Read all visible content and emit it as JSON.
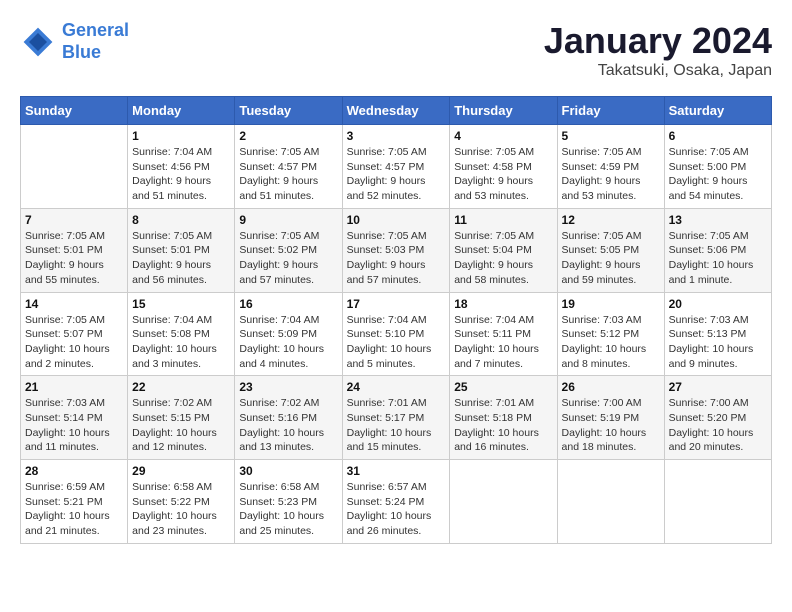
{
  "header": {
    "logo_line1": "General",
    "logo_line2": "Blue",
    "title": "January 2024",
    "subtitle": "Takatsuki, Osaka, Japan"
  },
  "weekdays": [
    "Sunday",
    "Monday",
    "Tuesday",
    "Wednesday",
    "Thursday",
    "Friday",
    "Saturday"
  ],
  "weeks": [
    [
      {
        "day": "",
        "info": ""
      },
      {
        "day": "1",
        "info": "Sunrise: 7:04 AM\nSunset: 4:56 PM\nDaylight: 9 hours\nand 51 minutes."
      },
      {
        "day": "2",
        "info": "Sunrise: 7:05 AM\nSunset: 4:57 PM\nDaylight: 9 hours\nand 51 minutes."
      },
      {
        "day": "3",
        "info": "Sunrise: 7:05 AM\nSunset: 4:57 PM\nDaylight: 9 hours\nand 52 minutes."
      },
      {
        "day": "4",
        "info": "Sunrise: 7:05 AM\nSunset: 4:58 PM\nDaylight: 9 hours\nand 53 minutes."
      },
      {
        "day": "5",
        "info": "Sunrise: 7:05 AM\nSunset: 4:59 PM\nDaylight: 9 hours\nand 53 minutes."
      },
      {
        "day": "6",
        "info": "Sunrise: 7:05 AM\nSunset: 5:00 PM\nDaylight: 9 hours\nand 54 minutes."
      }
    ],
    [
      {
        "day": "7",
        "info": "Sunrise: 7:05 AM\nSunset: 5:01 PM\nDaylight: 9 hours\nand 55 minutes."
      },
      {
        "day": "8",
        "info": "Sunrise: 7:05 AM\nSunset: 5:01 PM\nDaylight: 9 hours\nand 56 minutes."
      },
      {
        "day": "9",
        "info": "Sunrise: 7:05 AM\nSunset: 5:02 PM\nDaylight: 9 hours\nand 57 minutes."
      },
      {
        "day": "10",
        "info": "Sunrise: 7:05 AM\nSunset: 5:03 PM\nDaylight: 9 hours\nand 57 minutes."
      },
      {
        "day": "11",
        "info": "Sunrise: 7:05 AM\nSunset: 5:04 PM\nDaylight: 9 hours\nand 58 minutes."
      },
      {
        "day": "12",
        "info": "Sunrise: 7:05 AM\nSunset: 5:05 PM\nDaylight: 9 hours\nand 59 minutes."
      },
      {
        "day": "13",
        "info": "Sunrise: 7:05 AM\nSunset: 5:06 PM\nDaylight: 10 hours\nand 1 minute."
      }
    ],
    [
      {
        "day": "14",
        "info": "Sunrise: 7:05 AM\nSunset: 5:07 PM\nDaylight: 10 hours\nand 2 minutes."
      },
      {
        "day": "15",
        "info": "Sunrise: 7:04 AM\nSunset: 5:08 PM\nDaylight: 10 hours\nand 3 minutes."
      },
      {
        "day": "16",
        "info": "Sunrise: 7:04 AM\nSunset: 5:09 PM\nDaylight: 10 hours\nand 4 minutes."
      },
      {
        "day": "17",
        "info": "Sunrise: 7:04 AM\nSunset: 5:10 PM\nDaylight: 10 hours\nand 5 minutes."
      },
      {
        "day": "18",
        "info": "Sunrise: 7:04 AM\nSunset: 5:11 PM\nDaylight: 10 hours\nand 7 minutes."
      },
      {
        "day": "19",
        "info": "Sunrise: 7:03 AM\nSunset: 5:12 PM\nDaylight: 10 hours\nand 8 minutes."
      },
      {
        "day": "20",
        "info": "Sunrise: 7:03 AM\nSunset: 5:13 PM\nDaylight: 10 hours\nand 9 minutes."
      }
    ],
    [
      {
        "day": "21",
        "info": "Sunrise: 7:03 AM\nSunset: 5:14 PM\nDaylight: 10 hours\nand 11 minutes."
      },
      {
        "day": "22",
        "info": "Sunrise: 7:02 AM\nSunset: 5:15 PM\nDaylight: 10 hours\nand 12 minutes."
      },
      {
        "day": "23",
        "info": "Sunrise: 7:02 AM\nSunset: 5:16 PM\nDaylight: 10 hours\nand 13 minutes."
      },
      {
        "day": "24",
        "info": "Sunrise: 7:01 AM\nSunset: 5:17 PM\nDaylight: 10 hours\nand 15 minutes."
      },
      {
        "day": "25",
        "info": "Sunrise: 7:01 AM\nSunset: 5:18 PM\nDaylight: 10 hours\nand 16 minutes."
      },
      {
        "day": "26",
        "info": "Sunrise: 7:00 AM\nSunset: 5:19 PM\nDaylight: 10 hours\nand 18 minutes."
      },
      {
        "day": "27",
        "info": "Sunrise: 7:00 AM\nSunset: 5:20 PM\nDaylight: 10 hours\nand 20 minutes."
      }
    ],
    [
      {
        "day": "28",
        "info": "Sunrise: 6:59 AM\nSunset: 5:21 PM\nDaylight: 10 hours\nand 21 minutes."
      },
      {
        "day": "29",
        "info": "Sunrise: 6:58 AM\nSunset: 5:22 PM\nDaylight: 10 hours\nand 23 minutes."
      },
      {
        "day": "30",
        "info": "Sunrise: 6:58 AM\nSunset: 5:23 PM\nDaylight: 10 hours\nand 25 minutes."
      },
      {
        "day": "31",
        "info": "Sunrise: 6:57 AM\nSunset: 5:24 PM\nDaylight: 10 hours\nand 26 minutes."
      },
      {
        "day": "",
        "info": ""
      },
      {
        "day": "",
        "info": ""
      },
      {
        "day": "",
        "info": ""
      }
    ]
  ]
}
